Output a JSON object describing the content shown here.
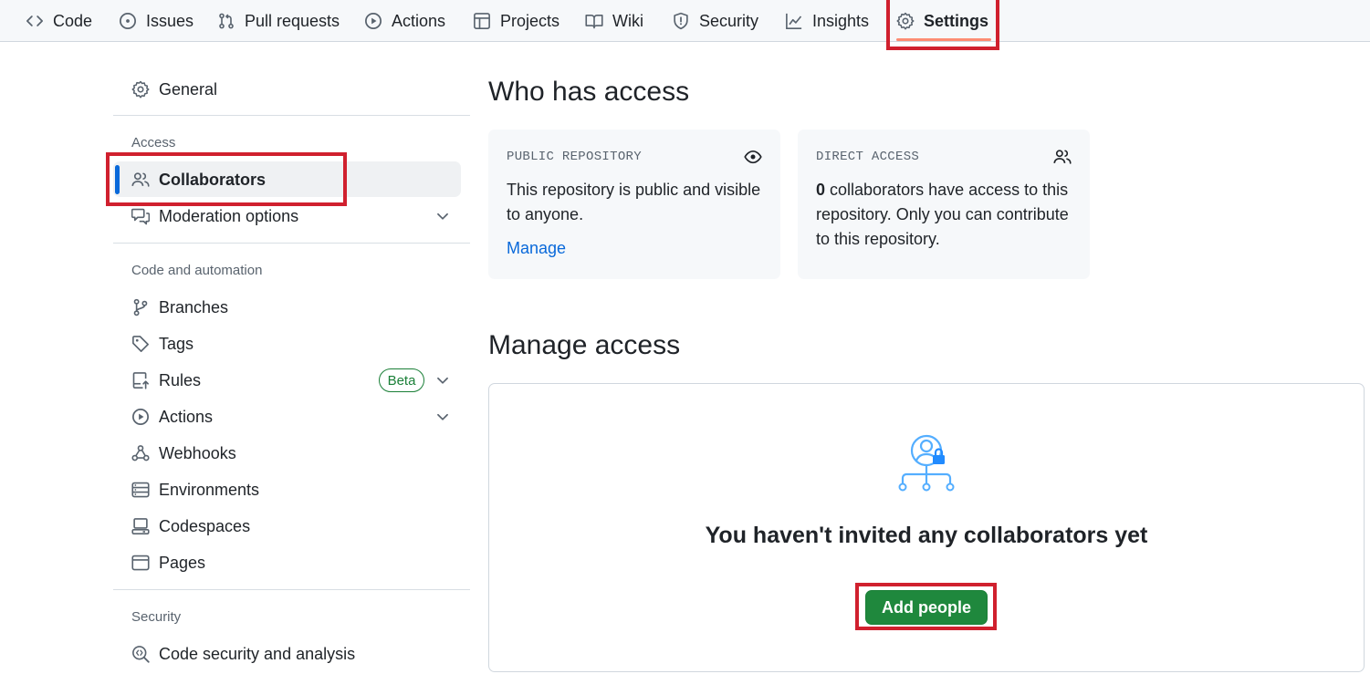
{
  "nav": {
    "tabs": [
      {
        "label": "Code",
        "icon": "code-icon"
      },
      {
        "label": "Issues",
        "icon": "issue-icon"
      },
      {
        "label": "Pull requests",
        "icon": "pull-request-icon"
      },
      {
        "label": "Actions",
        "icon": "play-icon"
      },
      {
        "label": "Projects",
        "icon": "table-icon"
      },
      {
        "label": "Wiki",
        "icon": "book-icon"
      },
      {
        "label": "Security",
        "icon": "shield-icon"
      },
      {
        "label": "Insights",
        "icon": "graph-icon"
      },
      {
        "label": "Settings",
        "icon": "gear-icon"
      }
    ],
    "active_tab": "Settings",
    "active_color": "#fd8c73"
  },
  "sidebar": {
    "general": "General",
    "sections": {
      "access": "Access",
      "code_automation": "Code and automation",
      "security": "Security"
    },
    "items": {
      "collaborators": "Collaborators",
      "moderation": "Moderation options",
      "branches": "Branches",
      "tags": "Tags",
      "rules": "Rules",
      "rules_badge": "Beta",
      "actions": "Actions",
      "webhooks": "Webhooks",
      "environments": "Environments",
      "codespaces": "Codespaces",
      "pages": "Pages",
      "code_security": "Code security and analysis"
    },
    "active_item": "Collaborators",
    "active_bar_color": "#0969da"
  },
  "main": {
    "who_title": "Who has access",
    "public_card": {
      "label": "PUBLIC REPOSITORY",
      "text": "This repository is public and visible to anyone.",
      "link": "Manage"
    },
    "direct_card": {
      "label": "DIRECT ACCESS",
      "count": "0",
      "text": " collaborators have access to this repository. Only you can contribute to this repository."
    },
    "manage_title": "Manage access",
    "empty_title": "You haven't invited any collaborators yet",
    "add_button": "Add people",
    "button_color": "#1f883d"
  },
  "highlight_color": "#d0202e"
}
